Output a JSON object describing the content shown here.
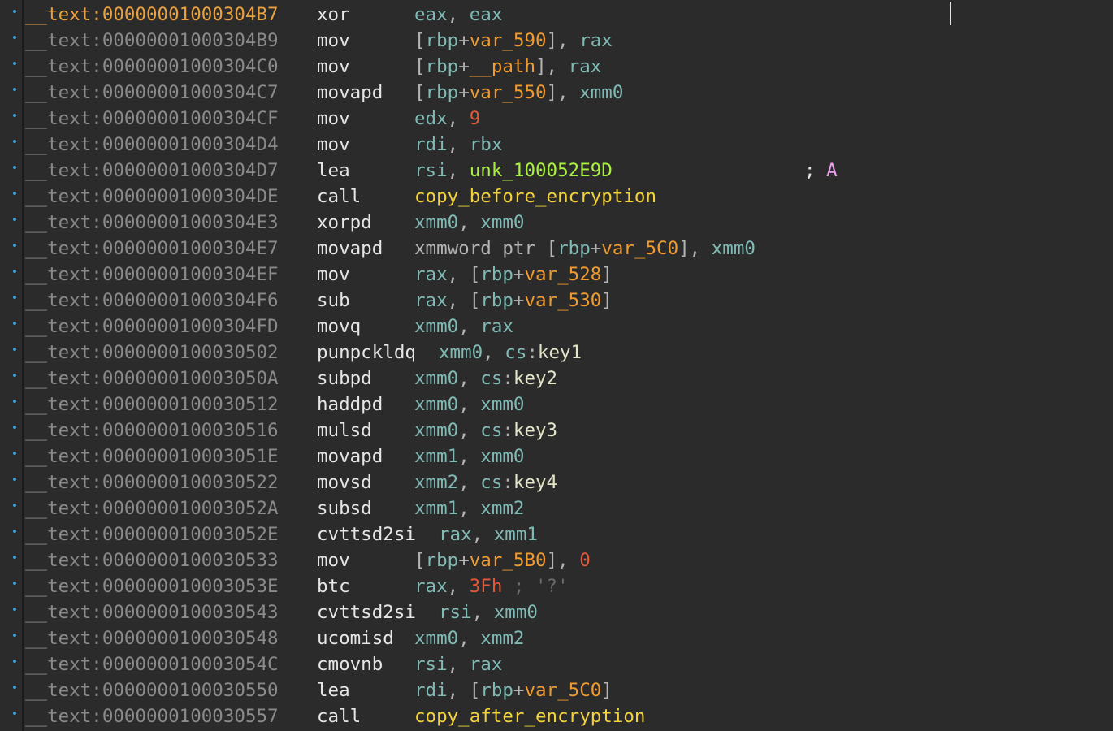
{
  "rows": [
    {
      "current": true,
      "addr": "__text:00000001000304B7",
      "mnem": "xor",
      "ops": [
        {
          "c": "reg",
          "t": "eax"
        },
        {
          "c": "p",
          "t": ", "
        },
        {
          "c": "reg",
          "t": "eax"
        }
      ]
    },
    {
      "addr": "__text:00000001000304B9",
      "mnem": "mov",
      "ops": [
        {
          "c": "p",
          "t": "["
        },
        {
          "c": "reg",
          "t": "rbp"
        },
        {
          "c": "p",
          "t": "+"
        },
        {
          "c": "var",
          "t": "var_590"
        },
        {
          "c": "p",
          "t": "], "
        },
        {
          "c": "reg",
          "t": "rax"
        }
      ]
    },
    {
      "addr": "__text:00000001000304C0",
      "mnem": "mov",
      "ops": [
        {
          "c": "p",
          "t": "["
        },
        {
          "c": "reg",
          "t": "rbp"
        },
        {
          "c": "p",
          "t": "+"
        },
        {
          "c": "var",
          "t": "__path"
        },
        {
          "c": "p",
          "t": "], "
        },
        {
          "c": "reg",
          "t": "rax"
        }
      ]
    },
    {
      "addr": "__text:00000001000304C7",
      "mnem": "movapd",
      "ops": [
        {
          "c": "p",
          "t": "["
        },
        {
          "c": "reg",
          "t": "rbp"
        },
        {
          "c": "p",
          "t": "+"
        },
        {
          "c": "var",
          "t": "var_550"
        },
        {
          "c": "p",
          "t": "], "
        },
        {
          "c": "reg",
          "t": "xmm0"
        }
      ]
    },
    {
      "addr": "__text:00000001000304CF",
      "mnem": "mov",
      "ops": [
        {
          "c": "reg",
          "t": "edx"
        },
        {
          "c": "p",
          "t": ", "
        },
        {
          "c": "num",
          "t": "9"
        }
      ]
    },
    {
      "addr": "__text:00000001000304D4",
      "mnem": "mov",
      "ops": [
        {
          "c": "reg",
          "t": "rdi"
        },
        {
          "c": "p",
          "t": ", "
        },
        {
          "c": "reg",
          "t": "rbx"
        }
      ]
    },
    {
      "addr": "__text:00000001000304D7",
      "mnem": "lea",
      "ops": [
        {
          "c": "reg",
          "t": "rsi"
        },
        {
          "c": "p",
          "t": ", "
        },
        {
          "c": "unk",
          "t": "unk_100052E9D"
        }
      ],
      "comment": "; ",
      "comment_char": "A"
    },
    {
      "addr": "__text:00000001000304DE",
      "mnem": "call",
      "ops": [
        {
          "c": "func",
          "t": "copy_before_encryption"
        }
      ]
    },
    {
      "addr": "__text:00000001000304E3",
      "mnem": "xorpd",
      "ops": [
        {
          "c": "reg",
          "t": "xmm0"
        },
        {
          "c": "p",
          "t": ", "
        },
        {
          "c": "reg",
          "t": "xmm0"
        }
      ]
    },
    {
      "addr": "__text:00000001000304E7",
      "mnem": "movapd",
      "ops": [
        {
          "c": "p",
          "t": "xmmword ptr ["
        },
        {
          "c": "reg",
          "t": "rbp"
        },
        {
          "c": "p",
          "t": "+"
        },
        {
          "c": "var",
          "t": "var_5C0"
        },
        {
          "c": "p",
          "t": "], "
        },
        {
          "c": "reg",
          "t": "xmm0"
        }
      ]
    },
    {
      "addr": "__text:00000001000304EF",
      "mnem": "mov",
      "ops": [
        {
          "c": "reg",
          "t": "rax"
        },
        {
          "c": "p",
          "t": ", ["
        },
        {
          "c": "reg",
          "t": "rbp"
        },
        {
          "c": "p",
          "t": "+"
        },
        {
          "c": "var",
          "t": "var_528"
        },
        {
          "c": "p",
          "t": "]"
        }
      ]
    },
    {
      "addr": "__text:00000001000304F6",
      "mnem": "sub",
      "ops": [
        {
          "c": "reg",
          "t": "rax"
        },
        {
          "c": "p",
          "t": ", ["
        },
        {
          "c": "reg",
          "t": "rbp"
        },
        {
          "c": "p",
          "t": "+"
        },
        {
          "c": "var",
          "t": "var_530"
        },
        {
          "c": "p",
          "t": "]"
        }
      ]
    },
    {
      "addr": "__text:00000001000304FD",
      "mnem": "movq",
      "ops": [
        {
          "c": "reg",
          "t": "xmm0"
        },
        {
          "c": "p",
          "t": ", "
        },
        {
          "c": "reg",
          "t": "rax"
        }
      ]
    },
    {
      "addr": "__text:0000000100030502",
      "mnem": "punpckldq",
      "shift": true,
      "ops": [
        {
          "c": "reg",
          "t": "xmm0"
        },
        {
          "c": "p",
          "t": ", "
        },
        {
          "c": "seg",
          "t": "cs"
        },
        {
          "c": "p",
          "t": ":"
        },
        {
          "c": "data",
          "t": "key1"
        }
      ]
    },
    {
      "addr": "__text:000000010003050A",
      "mnem": "subpd",
      "ops": [
        {
          "c": "reg",
          "t": "xmm0"
        },
        {
          "c": "p",
          "t": ", "
        },
        {
          "c": "seg",
          "t": "cs"
        },
        {
          "c": "p",
          "t": ":"
        },
        {
          "c": "data",
          "t": "key2"
        }
      ]
    },
    {
      "addr": "__text:0000000100030512",
      "mnem": "haddpd",
      "ops": [
        {
          "c": "reg",
          "t": "xmm0"
        },
        {
          "c": "p",
          "t": ", "
        },
        {
          "c": "reg",
          "t": "xmm0"
        }
      ]
    },
    {
      "addr": "__text:0000000100030516",
      "mnem": "mulsd",
      "ops": [
        {
          "c": "reg",
          "t": "xmm0"
        },
        {
          "c": "p",
          "t": ", "
        },
        {
          "c": "seg",
          "t": "cs"
        },
        {
          "c": "p",
          "t": ":"
        },
        {
          "c": "data",
          "t": "key3"
        }
      ]
    },
    {
      "addr": "__text:000000010003051E",
      "mnem": "movapd",
      "ops": [
        {
          "c": "reg",
          "t": "xmm1"
        },
        {
          "c": "p",
          "t": ", "
        },
        {
          "c": "reg",
          "t": "xmm0"
        }
      ]
    },
    {
      "addr": "__text:0000000100030522",
      "mnem": "movsd",
      "ops": [
        {
          "c": "reg",
          "t": "xmm2"
        },
        {
          "c": "p",
          "t": ", "
        },
        {
          "c": "seg",
          "t": "cs"
        },
        {
          "c": "p",
          "t": ":"
        },
        {
          "c": "data",
          "t": "key4"
        }
      ]
    },
    {
      "addr": "__text:000000010003052A",
      "mnem": "subsd",
      "ops": [
        {
          "c": "reg",
          "t": "xmm1"
        },
        {
          "c": "p",
          "t": ", "
        },
        {
          "c": "reg",
          "t": "xmm2"
        }
      ]
    },
    {
      "addr": "__text:000000010003052E",
      "mnem": "cvttsd2si",
      "shift": true,
      "ops": [
        {
          "c": "reg",
          "t": "rax"
        },
        {
          "c": "p",
          "t": ", "
        },
        {
          "c": "reg",
          "t": "xmm1"
        }
      ]
    },
    {
      "addr": "__text:0000000100030533",
      "mnem": "mov",
      "ops": [
        {
          "c": "p",
          "t": "["
        },
        {
          "c": "reg",
          "t": "rbp"
        },
        {
          "c": "p",
          "t": "+"
        },
        {
          "c": "var",
          "t": "var_5B0"
        },
        {
          "c": "p",
          "t": "], "
        },
        {
          "c": "num",
          "t": "0"
        }
      ]
    },
    {
      "addr": "__text:000000010003053E",
      "mnem": "btc",
      "ops": [
        {
          "c": "reg",
          "t": "rax"
        },
        {
          "c": "p",
          "t": ", "
        },
        {
          "c": "num",
          "t": "3Fh"
        },
        {
          "c": "cmt",
          "t": " ; '?'"
        }
      ]
    },
    {
      "addr": "__text:0000000100030543",
      "mnem": "cvttsd2si",
      "shift": true,
      "ops": [
        {
          "c": "reg",
          "t": "rsi"
        },
        {
          "c": "p",
          "t": ", "
        },
        {
          "c": "reg",
          "t": "xmm0"
        }
      ]
    },
    {
      "addr": "__text:0000000100030548",
      "mnem": "ucomisd",
      "ops": [
        {
          "c": "reg",
          "t": "xmm0"
        },
        {
          "c": "p",
          "t": ", "
        },
        {
          "c": "reg",
          "t": "xmm2"
        }
      ]
    },
    {
      "addr": "__text:000000010003054C",
      "mnem": "cmovnb",
      "ops": [
        {
          "c": "reg",
          "t": "rsi"
        },
        {
          "c": "p",
          "t": ", "
        },
        {
          "c": "reg",
          "t": "rax"
        }
      ]
    },
    {
      "addr": "__text:0000000100030550",
      "mnem": "lea",
      "ops": [
        {
          "c": "reg",
          "t": "rdi"
        },
        {
          "c": "p",
          "t": ", ["
        },
        {
          "c": "reg",
          "t": "rbp"
        },
        {
          "c": "p",
          "t": "+"
        },
        {
          "c": "var",
          "t": "var_5C0"
        },
        {
          "c": "p",
          "t": "]"
        }
      ]
    },
    {
      "addr": "__text:0000000100030557",
      "mnem": "call",
      "ops": [
        {
          "c": "func",
          "t": "copy_after_encryption"
        }
      ]
    }
  ],
  "colors": {
    "background": "#2b2b2b",
    "address": "#8a8a8a",
    "current_address": "#e8a040",
    "register": "#7fbab5",
    "variable": "#ef9b2f",
    "function": "#f4d23a",
    "number": "#e05a3a",
    "unknown_label": "#aaf040"
  }
}
